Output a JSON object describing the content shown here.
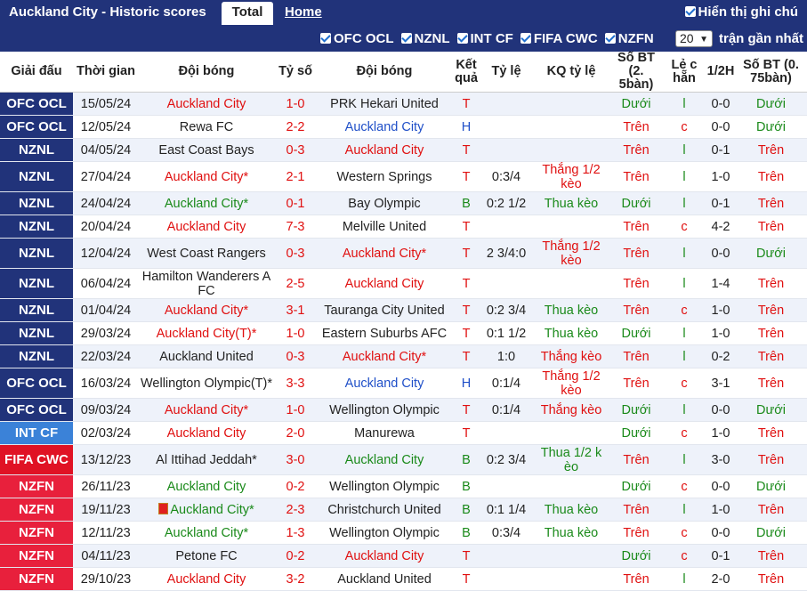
{
  "header": {
    "title": "Auckland City - Historic scores",
    "tab_total": "Total",
    "tab_home": "Home",
    "show_sub": "Hiển thị ghi chú"
  },
  "filters": {
    "items": [
      "OFC OCL",
      "NZNL",
      "INT CF",
      "FIFA CWC",
      "NZFN"
    ],
    "count_value": "20",
    "recent_label": "trận gần nhất"
  },
  "columns": [
    "Giải đấu",
    "Thời gian",
    "Đội bóng",
    "Tỷ số",
    "Đội bóng",
    "Kết quả",
    "Tỷ lệ",
    "KQ tỷ lệ",
    "Số BT (2. 5bàn)",
    "Lẻ c hẵn",
    "1/2H",
    "Số BT (0. 75bàn)"
  ],
  "colors": {
    "OFC OCL": "#21337a",
    "NZNL": "#21337a",
    "INT CF": "#3b82d8",
    "FIFA CWC": "#e01224",
    "NZFN": "#e8203c"
  },
  "rows": [
    {
      "league": "OFC OCL",
      "date": "15/05/24",
      "home": "Auckland City",
      "home_c": "red",
      "score": "1-0",
      "away": "PRK Hekari United",
      "away_c": "dark",
      "res": "T",
      "res_c": "red",
      "odds": "",
      "odds_res": "",
      "odds_res_c": "",
      "bt25": "Dưới",
      "bt25_c": "green",
      "oe": "l",
      "oe_c": "green",
      "half": "0-0",
      "bt075": "Dưới",
      "bt075_c": "green"
    },
    {
      "league": "OFC OCL",
      "date": "12/05/24",
      "home": "Rewa FC",
      "home_c": "dark",
      "score": "2-2",
      "away": "Auckland City",
      "away_c": "blue",
      "res": "H",
      "res_c": "blue",
      "odds": "",
      "odds_res": "",
      "odds_res_c": "",
      "bt25": "Trên",
      "bt25_c": "red",
      "oe": "c",
      "oe_c": "red",
      "half": "0-0",
      "bt075": "Dưới",
      "bt075_c": "green"
    },
    {
      "league": "NZNL",
      "date": "04/05/24",
      "home": "East Coast Bays",
      "home_c": "dark",
      "score": "0-3",
      "away": "Auckland City",
      "away_c": "red",
      "res": "T",
      "res_c": "red",
      "odds": "",
      "odds_res": "",
      "odds_res_c": "",
      "bt25": "Trên",
      "bt25_c": "red",
      "oe": "l",
      "oe_c": "green",
      "half": "0-1",
      "bt075": "Trên",
      "bt075_c": "red"
    },
    {
      "league": "NZNL",
      "date": "27/04/24",
      "home": "Auckland City*",
      "home_c": "red",
      "score": "2-1",
      "away": "Western Springs",
      "away_c": "dark",
      "res": "T",
      "res_c": "red",
      "odds": "0:3/4",
      "odds_res": "Thắng 1/2 kèo",
      "odds_res_c": "red",
      "bt25": "Trên",
      "bt25_c": "red",
      "oe": "l",
      "oe_c": "green",
      "half": "1-0",
      "bt075": "Trên",
      "bt075_c": "red"
    },
    {
      "league": "NZNL",
      "date": "24/04/24",
      "home": "Auckland City*",
      "home_c": "green",
      "score": "0-1",
      "away": "Bay Olympic",
      "away_c": "dark",
      "res": "B",
      "res_c": "green",
      "odds": "0:2 1/2",
      "odds_res": "Thua kèo",
      "odds_res_c": "green",
      "bt25": "Dưới",
      "bt25_c": "green",
      "oe": "l",
      "oe_c": "green",
      "half": "0-1",
      "bt075": "Trên",
      "bt075_c": "red"
    },
    {
      "league": "NZNL",
      "date": "20/04/24",
      "home": "Auckland City",
      "home_c": "red",
      "score": "7-3",
      "away": "Melville United",
      "away_c": "dark",
      "res": "T",
      "res_c": "red",
      "odds": "",
      "odds_res": "",
      "odds_res_c": "",
      "bt25": "Trên",
      "bt25_c": "red",
      "oe": "c",
      "oe_c": "red",
      "half": "4-2",
      "bt075": "Trên",
      "bt075_c": "red"
    },
    {
      "league": "NZNL",
      "date": "12/04/24",
      "home": "West Coast Rangers",
      "home_c": "dark",
      "score": "0-3",
      "away": "Auckland City*",
      "away_c": "red",
      "res": "T",
      "res_c": "red",
      "odds": "2 3/4:0",
      "odds_res": "Thắng 1/2 kèo",
      "odds_res_c": "red",
      "bt25": "Trên",
      "bt25_c": "red",
      "oe": "l",
      "oe_c": "green",
      "half": "0-0",
      "bt075": "Dưới",
      "bt075_c": "green"
    },
    {
      "league": "NZNL",
      "date": "06/04/24",
      "home": "Hamilton Wanderers A FC",
      "home_c": "dark",
      "score": "2-5",
      "away": "Auckland City",
      "away_c": "red",
      "res": "T",
      "res_c": "red",
      "odds": "",
      "odds_res": "",
      "odds_res_c": "",
      "bt25": "Trên",
      "bt25_c": "red",
      "oe": "l",
      "oe_c": "green",
      "half": "1-4",
      "bt075": "Trên",
      "bt075_c": "red"
    },
    {
      "league": "NZNL",
      "date": "01/04/24",
      "home": "Auckland City*",
      "home_c": "red",
      "score": "3-1",
      "away": "Tauranga City United",
      "away_c": "dark",
      "res": "T",
      "res_c": "red",
      "odds": "0:2 3/4",
      "odds_res": "Thua kèo",
      "odds_res_c": "green",
      "bt25": "Trên",
      "bt25_c": "red",
      "oe": "c",
      "oe_c": "red",
      "half": "1-0",
      "bt075": "Trên",
      "bt075_c": "red"
    },
    {
      "league": "NZNL",
      "date": "29/03/24",
      "home": "Auckland City(T)*",
      "home_c": "red",
      "score": "1-0",
      "away": "Eastern Suburbs AFC",
      "away_c": "dark",
      "res": "T",
      "res_c": "red",
      "odds": "0:1 1/2",
      "odds_res": "Thua kèo",
      "odds_res_c": "green",
      "bt25": "Dưới",
      "bt25_c": "green",
      "oe": "l",
      "oe_c": "green",
      "half": "1-0",
      "bt075": "Trên",
      "bt075_c": "red"
    },
    {
      "league": "NZNL",
      "date": "22/03/24",
      "home": "Auckland United",
      "home_c": "dark",
      "score": "0-3",
      "away": "Auckland City*",
      "away_c": "red",
      "res": "T",
      "res_c": "red",
      "odds": "1:0",
      "odds_res": "Thắng kèo",
      "odds_res_c": "red",
      "bt25": "Trên",
      "bt25_c": "red",
      "oe": "l",
      "oe_c": "green",
      "half": "0-2",
      "bt075": "Trên",
      "bt075_c": "red"
    },
    {
      "league": "OFC OCL",
      "date": "16/03/24",
      "home": "Wellington Olympic(T)*",
      "home_c": "dark",
      "score": "3-3",
      "away": "Auckland City",
      "away_c": "blue",
      "res": "H",
      "res_c": "blue",
      "odds": "0:1/4",
      "odds_res": "Thắng 1/2 kèo",
      "odds_res_c": "red",
      "bt25": "Trên",
      "bt25_c": "red",
      "oe": "c",
      "oe_c": "red",
      "half": "3-1",
      "bt075": "Trên",
      "bt075_c": "red"
    },
    {
      "league": "OFC OCL",
      "date": "09/03/24",
      "home": "Auckland City*",
      "home_c": "red",
      "score": "1-0",
      "away": "Wellington Olympic",
      "away_c": "dark",
      "res": "T",
      "res_c": "red",
      "odds": "0:1/4",
      "odds_res": "Thắng kèo",
      "odds_res_c": "red",
      "bt25": "Dưới",
      "bt25_c": "green",
      "oe": "l",
      "oe_c": "green",
      "half": "0-0",
      "bt075": "Dưới",
      "bt075_c": "green"
    },
    {
      "league": "INT CF",
      "date": "02/03/24",
      "home": "Auckland City",
      "home_c": "red",
      "score": "2-0",
      "away": "Manurewa",
      "away_c": "dark",
      "res": "T",
      "res_c": "red",
      "odds": "",
      "odds_res": "",
      "odds_res_c": "",
      "bt25": "Dưới",
      "bt25_c": "green",
      "oe": "c",
      "oe_c": "red",
      "half": "1-0",
      "bt075": "Trên",
      "bt075_c": "red"
    },
    {
      "league": "FIFA CWC",
      "date": "13/12/23",
      "home": "Al Ittihad Jeddah*",
      "home_c": "dark",
      "score": "3-0",
      "away": "Auckland City",
      "away_c": "green",
      "res": "B",
      "res_c": "green",
      "odds": "0:2 3/4",
      "odds_res": "Thua 1/2 k èo",
      "odds_res_c": "green",
      "bt25": "Trên",
      "bt25_c": "red",
      "oe": "l",
      "oe_c": "green",
      "half": "3-0",
      "bt075": "Trên",
      "bt075_c": "red"
    },
    {
      "league": "NZFN",
      "date": "26/11/23",
      "home": "Auckland City",
      "home_c": "green",
      "score": "0-2",
      "away": "Wellington Olympic",
      "away_c": "dark",
      "res": "B",
      "res_c": "green",
      "odds": "",
      "odds_res": "",
      "odds_res_c": "",
      "bt25": "Dưới",
      "bt25_c": "green",
      "oe": "c",
      "oe_c": "red",
      "half": "0-0",
      "bt075": "Dưới",
      "bt075_c": "green"
    },
    {
      "league": "NZFN",
      "date": "19/11/23",
      "home": "Auckland City*",
      "home_c": "green",
      "flag": true,
      "score": "2-3",
      "away": "Christchurch United",
      "away_c": "dark",
      "res": "B",
      "res_c": "green",
      "odds": "0:1 1/4",
      "odds_res": "Thua kèo",
      "odds_res_c": "green",
      "bt25": "Trên",
      "bt25_c": "red",
      "oe": "l",
      "oe_c": "green",
      "half": "1-0",
      "bt075": "Trên",
      "bt075_c": "red"
    },
    {
      "league": "NZFN",
      "date": "12/11/23",
      "home": "Auckland City*",
      "home_c": "green",
      "score": "1-3",
      "away": "Wellington Olympic",
      "away_c": "dark",
      "res": "B",
      "res_c": "green",
      "odds": "0:3/4",
      "odds_res": "Thua kèo",
      "odds_res_c": "green",
      "bt25": "Trên",
      "bt25_c": "red",
      "oe": "c",
      "oe_c": "red",
      "half": "0-0",
      "bt075": "Dưới",
      "bt075_c": "green"
    },
    {
      "league": "NZFN",
      "date": "04/11/23",
      "home": "Petone FC",
      "home_c": "dark",
      "score": "0-2",
      "away": "Auckland City",
      "away_c": "red",
      "res": "T",
      "res_c": "red",
      "odds": "",
      "odds_res": "",
      "odds_res_c": "",
      "bt25": "Dưới",
      "bt25_c": "green",
      "oe": "c",
      "oe_c": "red",
      "half": "0-1",
      "bt075": "Trên",
      "bt075_c": "red"
    },
    {
      "league": "NZFN",
      "date": "29/10/23",
      "home": "Auckland City",
      "home_c": "red",
      "score": "3-2",
      "away": "Auckland United",
      "away_c": "dark",
      "res": "T",
      "res_c": "red",
      "odds": "",
      "odds_res": "",
      "odds_res_c": "",
      "bt25": "Trên",
      "bt25_c": "red",
      "oe": "l",
      "oe_c": "green",
      "half": "2-0",
      "bt075": "Trên",
      "bt075_c": "red"
    }
  ]
}
